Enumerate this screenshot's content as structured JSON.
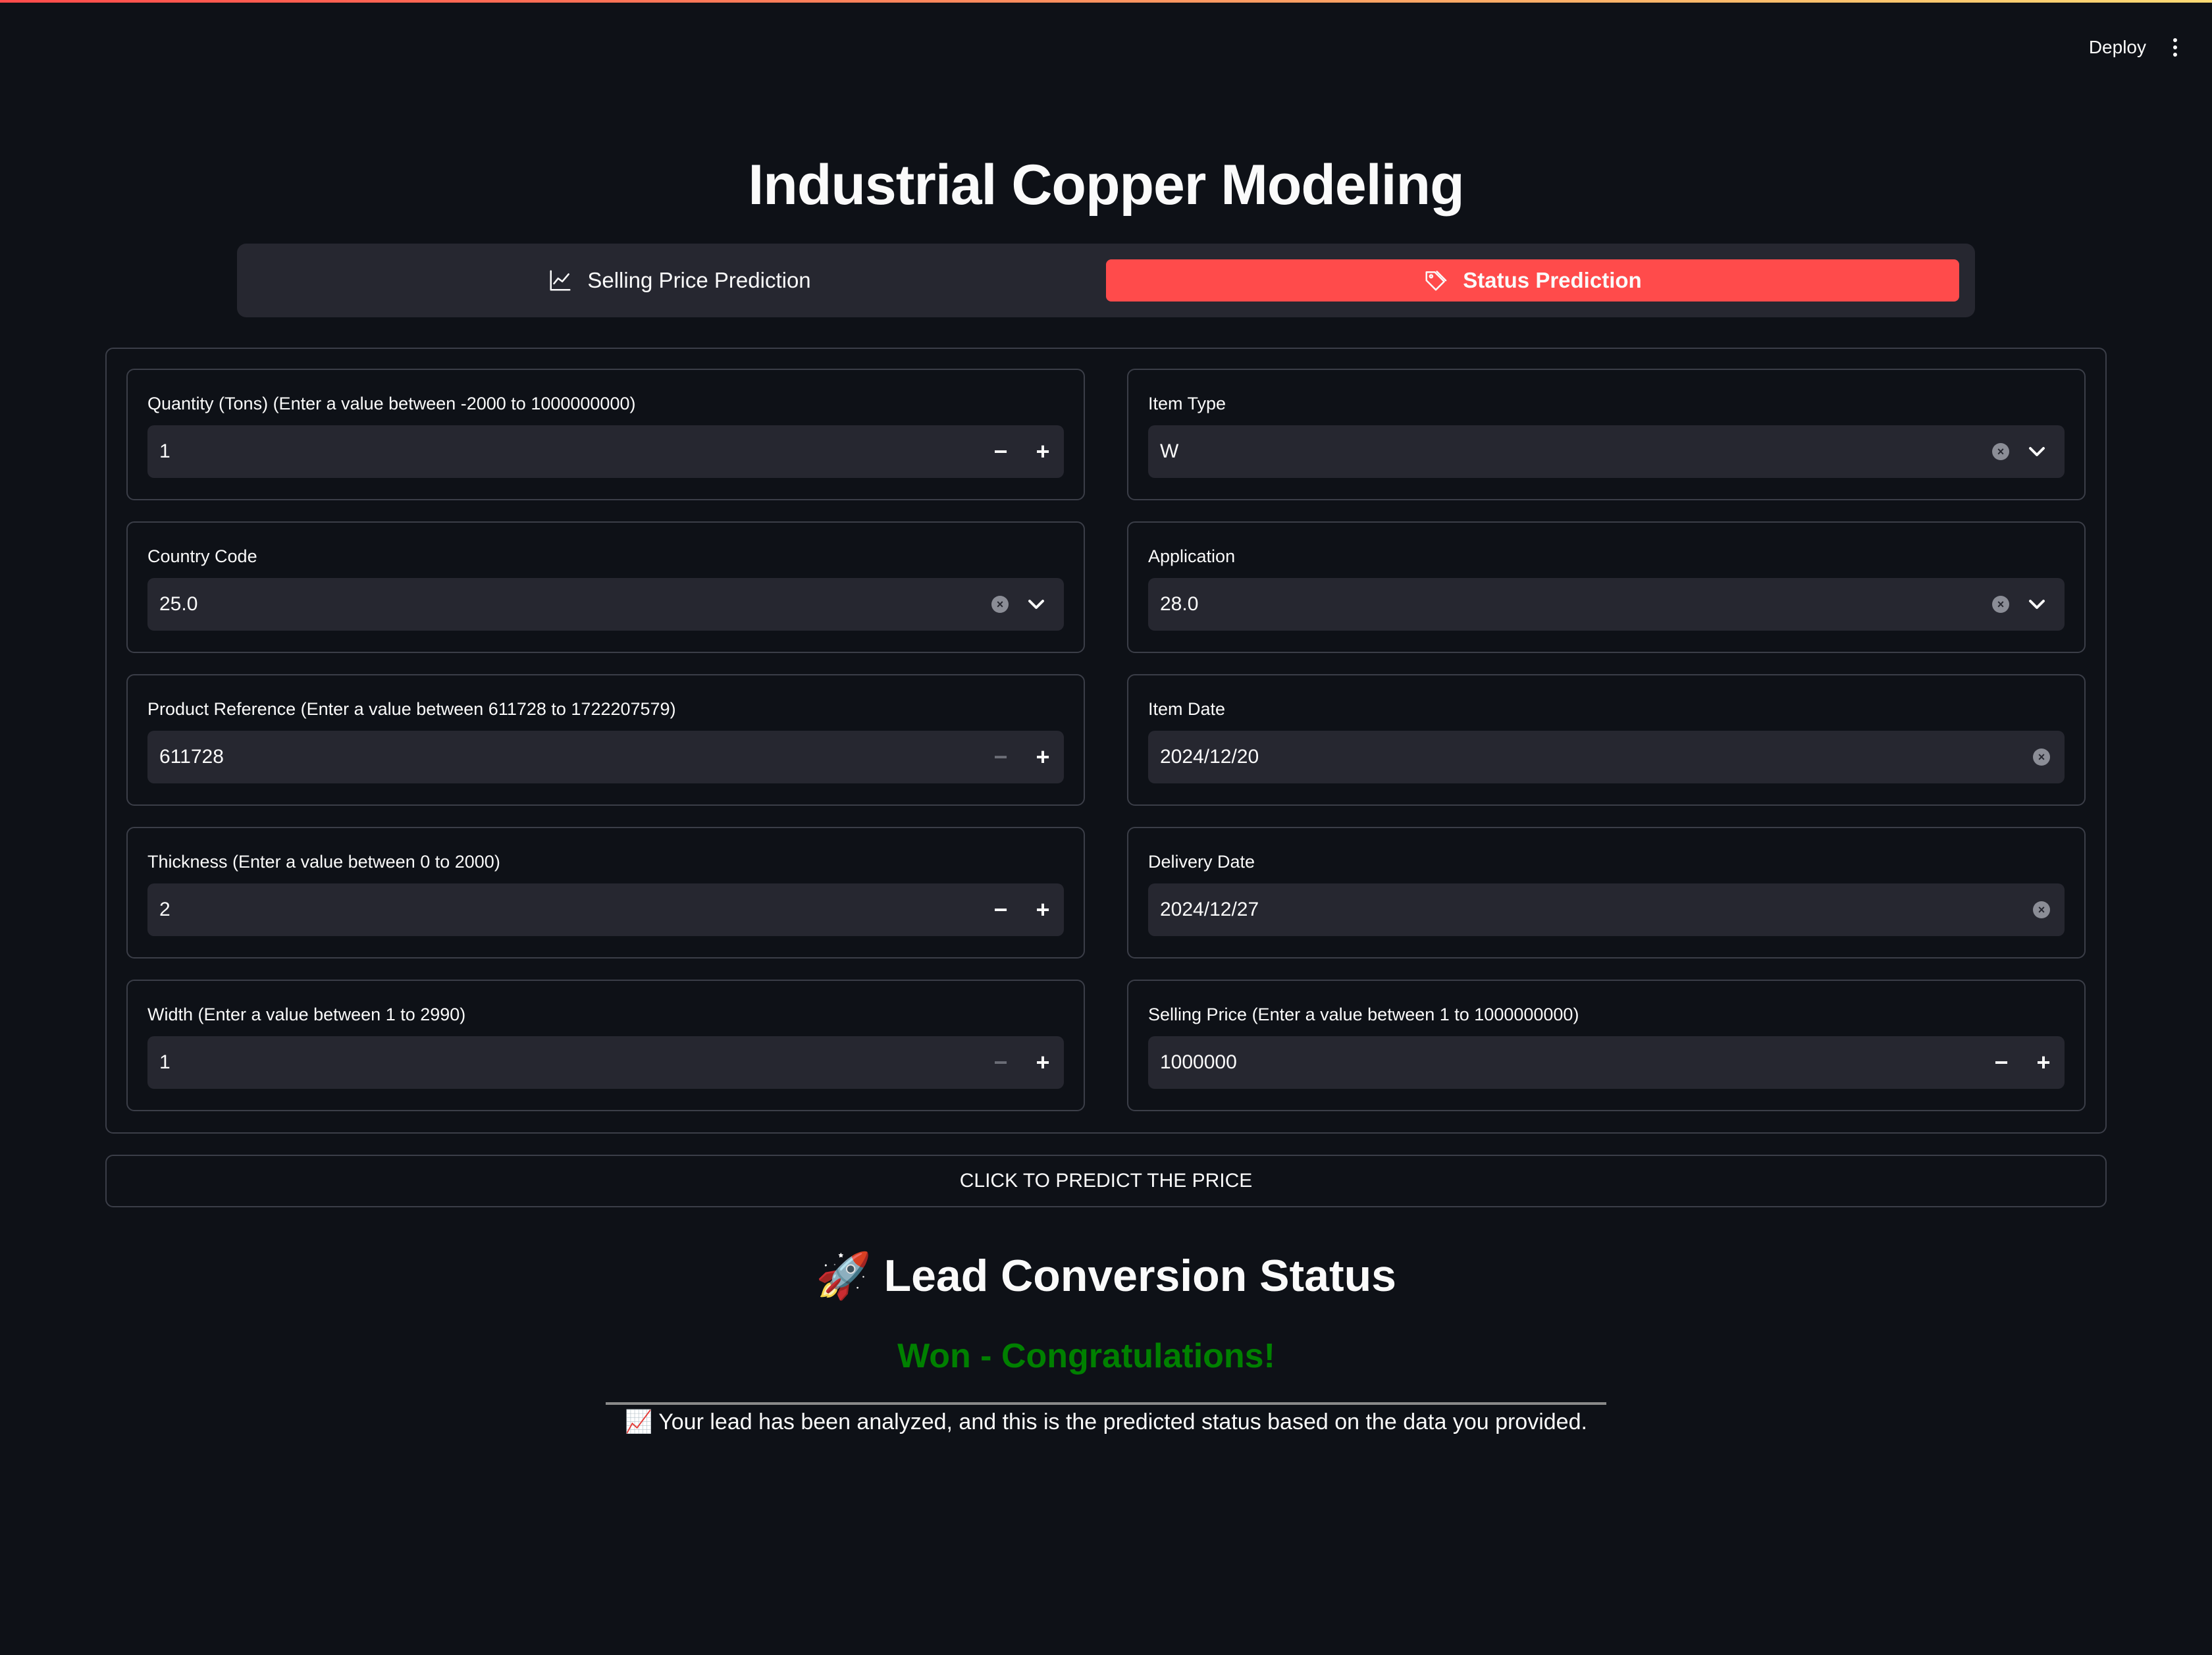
{
  "header": {
    "deploy_label": "Deploy"
  },
  "page": {
    "title": "Industrial Copper Modeling"
  },
  "tabs": [
    {
      "label": "Selling Price Prediction",
      "icon": "chart-line-icon",
      "active": false
    },
    {
      "label": "Status Prediction",
      "icon": "tag-icon",
      "active": true
    }
  ],
  "form": {
    "quantity": {
      "label": "Quantity (Tons) (Enter a value between -2000 to 1000000000)",
      "value": "1"
    },
    "item_type": {
      "label": "Item Type",
      "value": "W"
    },
    "country_code": {
      "label": "Country Code",
      "value": "25.0"
    },
    "application": {
      "label": "Application",
      "value": "28.0"
    },
    "product_ref": {
      "label": "Product Reference (Enter a value between 611728 to 1722207579)",
      "value": "611728"
    },
    "item_date": {
      "label": "Item Date",
      "value": "2024/12/20"
    },
    "thickness": {
      "label": "Thickness (Enter a value between 0 to 2000)",
      "value": "2"
    },
    "delivery_date": {
      "label": "Delivery Date",
      "value": "2024/12/27"
    },
    "width": {
      "label": "Width (Enter a value between 1 to 2990)",
      "value": "1"
    },
    "selling_price": {
      "label": "Selling Price (Enter a value between 1 to 1000000000)",
      "value": "1000000"
    }
  },
  "stepper": {
    "minus": "−",
    "plus": "+"
  },
  "predict_button": "CLICK TO PREDICT THE PRICE",
  "result": {
    "title": "🚀 Lead Conversion Status",
    "status": "Won - Congratulations!",
    "note": "📈 Your lead has been analyzed, and this is the predicted status based on the data you provided."
  },
  "colors": {
    "accent": "#ff4b4b",
    "background": "#0e1117",
    "input": "#262730",
    "success": "#008000"
  }
}
